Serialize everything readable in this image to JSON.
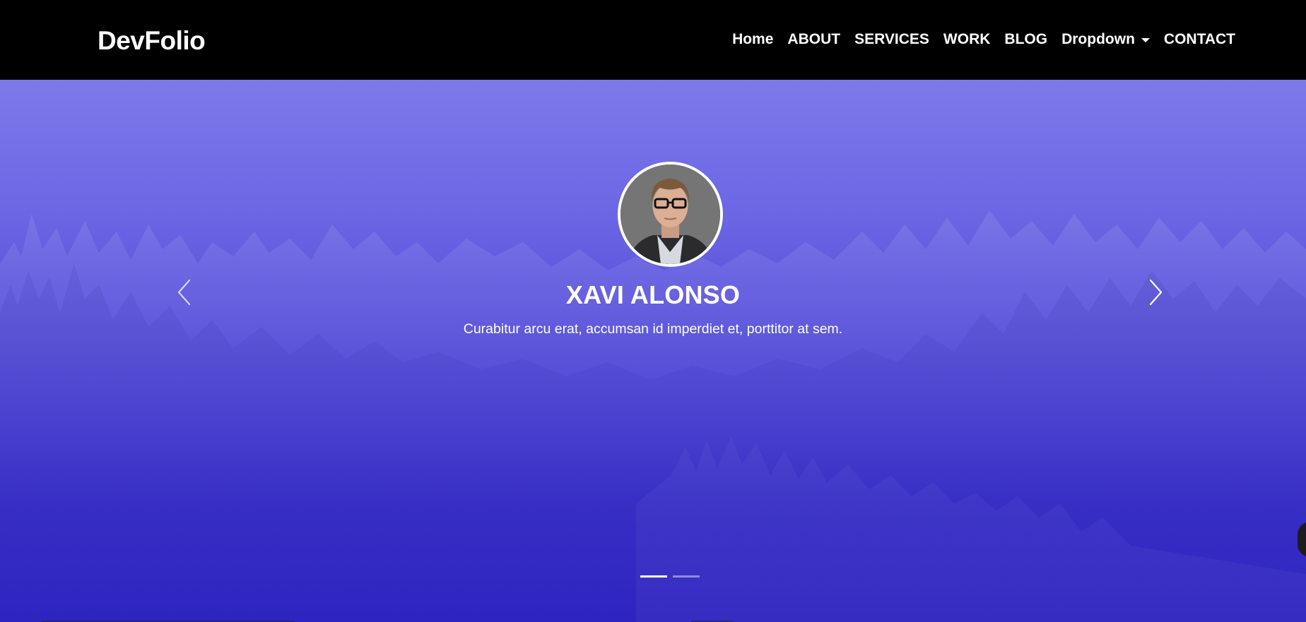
{
  "header": {
    "brand": "DevFolio",
    "nav": [
      {
        "label": "Home"
      },
      {
        "label": "ABOUT"
      },
      {
        "label": "SERVICES"
      },
      {
        "label": "WORK"
      },
      {
        "label": "BLOG"
      },
      {
        "label": "Dropdown",
        "icon": "caret-down-icon"
      },
      {
        "label": "CONTACT"
      }
    ]
  },
  "hero": {
    "name": "XAVI ALONSO",
    "tagline": "Curabitur arcu erat, accumsan id imperdiet et, porttitor at sem.",
    "prev_icon": "chevron-left-icon",
    "next_icon": "chevron-right-icon",
    "slides_total": 2,
    "active_slide": 1
  },
  "colors": {
    "navbar_bg": "#000000",
    "hero_top": "#7d79ea",
    "hero_bottom": "#2a20c0",
    "text": "#ffffff"
  }
}
